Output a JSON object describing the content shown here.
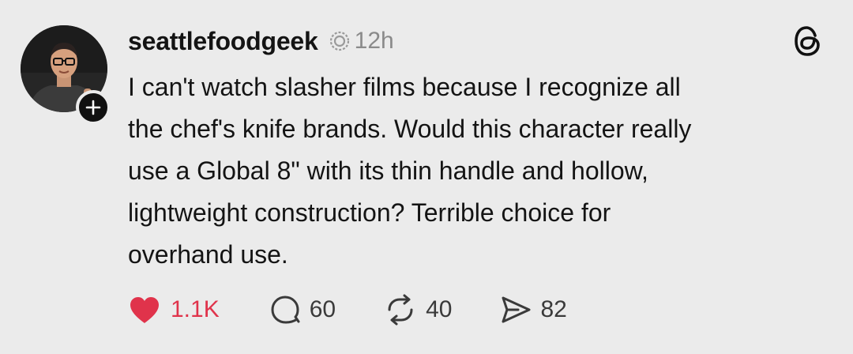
{
  "post": {
    "username": "seattlefoodgeek",
    "timestamp": "12h",
    "text": "I can't watch slasher films because I recognize all\nthe chef's knife brands. Would this character really\nuse a Global 8\" with its thin handle and hollow,\nlightweight construction? Terrible choice for\noverhand use.",
    "icons": {
      "avatar": "profile-photo",
      "follow": "plus-icon",
      "verified": "verified-badge-icon",
      "app": "threads-logo-icon"
    }
  },
  "actions": {
    "likes": "1.1K",
    "replies": "60",
    "reposts": "40",
    "shares": "82",
    "icons": [
      "heart-icon",
      "reply-bubble-icon",
      "repost-icon",
      "share-send-icon"
    ]
  },
  "colors": {
    "background": "#ebebeb",
    "text": "#141414",
    "muted": "#8a8a8a",
    "like": "#e0334b"
  }
}
